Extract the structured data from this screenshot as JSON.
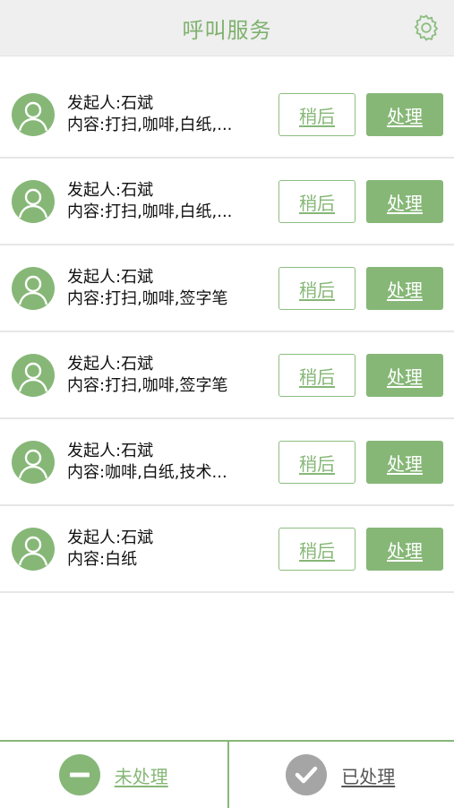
{
  "header": {
    "title": "呼叫服务",
    "settings_icon": "gear-icon"
  },
  "rows": [
    {
      "initiator": "发起人:石斌",
      "content": "内容:打扫,咖啡,白纸,...",
      "later_label": "稍后",
      "handle_label": "处理"
    },
    {
      "initiator": "发起人:石斌",
      "content": "内容:打扫,咖啡,白纸,...",
      "later_label": "稍后",
      "handle_label": "处理"
    },
    {
      "initiator": "发起人:石斌",
      "content": "内容:打扫,咖啡,签字笔",
      "later_label": "稍后",
      "handle_label": "处理"
    },
    {
      "initiator": "发起人:石斌",
      "content": "内容:打扫,咖啡,签字笔",
      "later_label": "稍后",
      "handle_label": "处理"
    },
    {
      "initiator": "发起人:石斌",
      "content": "内容:咖啡,白纸,技术...",
      "later_label": "稍后",
      "handle_label": "处理"
    },
    {
      "initiator": "发起人:石斌",
      "content": "内容:白纸",
      "later_label": "稍后",
      "handle_label": "处理"
    }
  ],
  "footer": {
    "tabs": [
      {
        "label": "未处理",
        "icon": "minus-circle-icon",
        "active": true
      },
      {
        "label": "已处理",
        "icon": "check-circle-icon",
        "active": false
      }
    ]
  },
  "colors": {
    "accent": "#86b777",
    "header_bg": "#efefef",
    "inactive_icon": "#a5a5a5"
  }
}
